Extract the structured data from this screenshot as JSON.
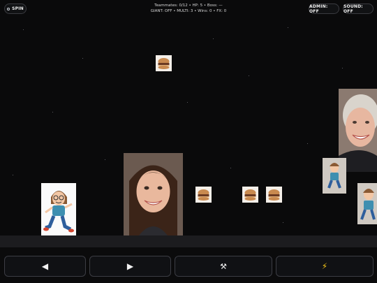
{
  "top_left": {
    "spin_label": "SPIN",
    "icon": "circle-icon"
  },
  "hud": {
    "line1": "Teammates: 0/12 • HP: 5 • Boss: —",
    "line2": "GIANT: OFF • MULTI: 3 • Wins: 0 • FX: 0"
  },
  "top_right": {
    "admin_label": "ADMIN: OFF",
    "sound_label": "SOUND: OFF"
  },
  "controls": {
    "left_label": "◀",
    "right_label": "▶",
    "hammer_label": "⚒",
    "lightning_label": "⚡"
  },
  "colors": {
    "background": "#0a0a0b",
    "ground": "#1c1c1f",
    "button_border": "#3c3d44"
  },
  "sprites": {
    "player": "cartoon-runner",
    "burgers": [
      "burger-icon",
      "burger-icon",
      "burger-icon",
      "burger-icon"
    ],
    "faces": [
      "smiling-girl-photo",
      "smiling-older-woman-photo"
    ],
    "teammates": [
      "cartoon-runner-small",
      "cartoon-runner-small"
    ]
  }
}
